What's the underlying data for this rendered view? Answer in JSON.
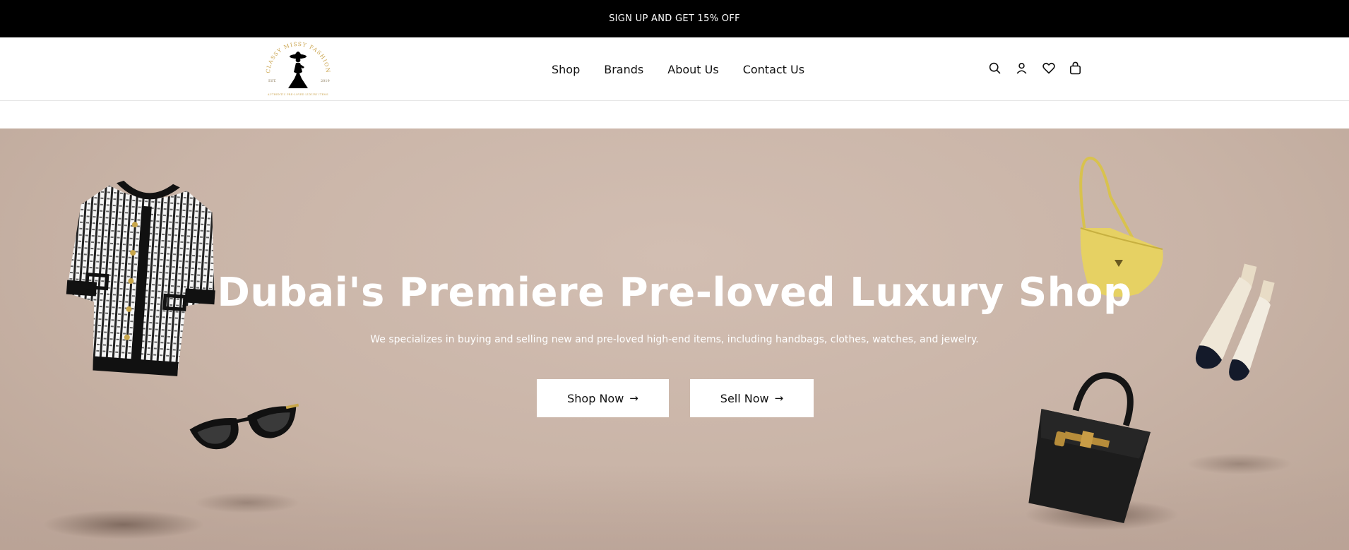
{
  "announcement": {
    "text": "SIGN UP AND GET 15% OFF"
  },
  "header": {
    "logo": {
      "brand_text": "CLASSY MISSY FASHION",
      "est": "EST.",
      "year": "2019",
      "tagline": "AUTHENTIC PRE-LOVED LUXURY ITEMS"
    },
    "nav": [
      {
        "label": "Shop"
      },
      {
        "label": "Brands"
      },
      {
        "label": "About Us"
      },
      {
        "label": "Contact Us"
      }
    ],
    "icons": [
      "search-icon",
      "account-icon",
      "wishlist-heart-icon",
      "shopping-bag-icon"
    ]
  },
  "hero": {
    "title": "Dubai's Premiere Pre-loved Luxury Shop",
    "subtitle": "We specializes in buying and selling new and pre-loved high-end items, including handbags, clothes, watches, and jewelry.",
    "buttons": [
      {
        "label": "Shop Now"
      },
      {
        "label": "Sell Now"
      }
    ],
    "arrow_glyph": "→"
  },
  "colors": {
    "announce_bg": "#000000",
    "hero_bg": "#c9b4a7",
    "button_bg": "#ffffff",
    "text_light": "#ffffff"
  }
}
